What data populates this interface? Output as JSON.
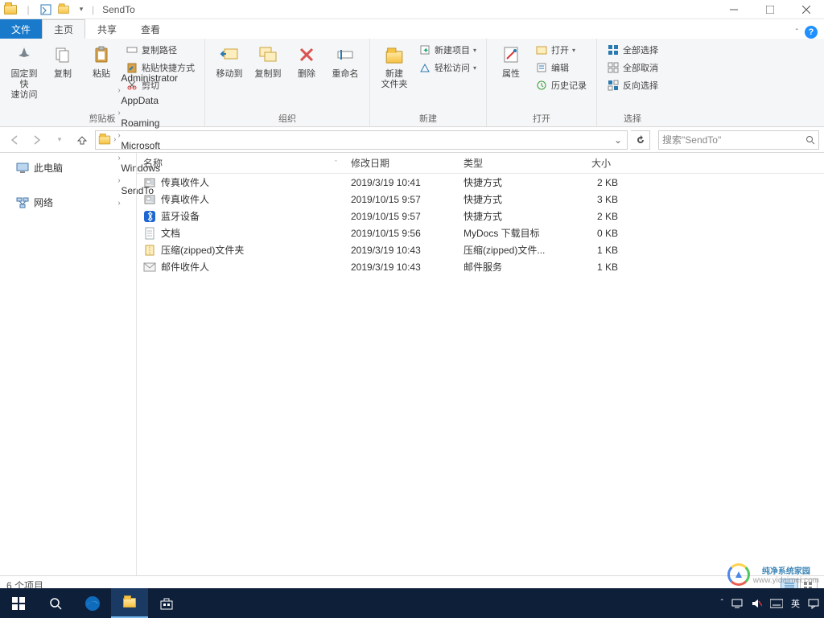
{
  "window": {
    "title": "SendTo",
    "qat_dropdown": "▾"
  },
  "tabs": {
    "file": "文件",
    "home": "主页",
    "share": "共享",
    "view": "查看",
    "help_icon": "?"
  },
  "ribbon": {
    "clipboard": {
      "pin": "固定到快\n速访问",
      "copy": "复制",
      "paste": "粘贴",
      "copy_path": "复制路径",
      "paste_shortcut": "粘贴快捷方式",
      "cut": "剪切",
      "group": "剪贴板"
    },
    "organize": {
      "move_to": "移动到",
      "copy_to": "复制到",
      "delete": "删除",
      "rename": "重命名",
      "group": "组织"
    },
    "new": {
      "new_folder": "新建\n文件夹",
      "new_item": "新建项目",
      "easy_access": "轻松访问",
      "group": "新建"
    },
    "open": {
      "properties": "属性",
      "open": "打开",
      "edit": "编辑",
      "history": "历史记录",
      "group": "打开"
    },
    "select": {
      "select_all": "全部选择",
      "select_none": "全部取消",
      "invert": "反向选择",
      "group": "选择"
    }
  },
  "breadcrumb": {
    "items": [
      "Administrator",
      "AppData",
      "Roaming",
      "Microsoft",
      "Windows",
      "SendTo"
    ]
  },
  "search": {
    "placeholder": "搜索\"SendTo\""
  },
  "sidebar": {
    "this_pc": "此电脑",
    "network": "网络"
  },
  "columns": {
    "name": "名称",
    "date": "修改日期",
    "type": "类型",
    "size": "大小"
  },
  "files": [
    {
      "icon": "fax",
      "name": "传真收件人",
      "date": "2019/3/19 10:41",
      "type": "快捷方式",
      "size": "2 KB"
    },
    {
      "icon": "fax",
      "name": "传真收件人",
      "date": "2019/10/15 9:57",
      "type": "快捷方式",
      "size": "3 KB"
    },
    {
      "icon": "bt",
      "name": "蓝牙设备",
      "date": "2019/10/15 9:57",
      "type": "快捷方式",
      "size": "2 KB"
    },
    {
      "icon": "doc",
      "name": "文档",
      "date": "2019/10/15 9:56",
      "type": "MyDocs 下载目标",
      "size": "0 KB"
    },
    {
      "icon": "zip",
      "name": "压缩(zipped)文件夹",
      "date": "2019/3/19 10:43",
      "type": "压缩(zipped)文件...",
      "size": "1 KB"
    },
    {
      "icon": "mail",
      "name": "邮件收件人",
      "date": "2019/3/19 10:43",
      "type": "邮件服务",
      "size": "1 KB"
    }
  ],
  "status": {
    "item_count": "6 个项目"
  },
  "tray": {
    "ime": "英"
  },
  "watermark": {
    "line1": "纯净系统家园",
    "line2": "www.yidaimei.com"
  }
}
